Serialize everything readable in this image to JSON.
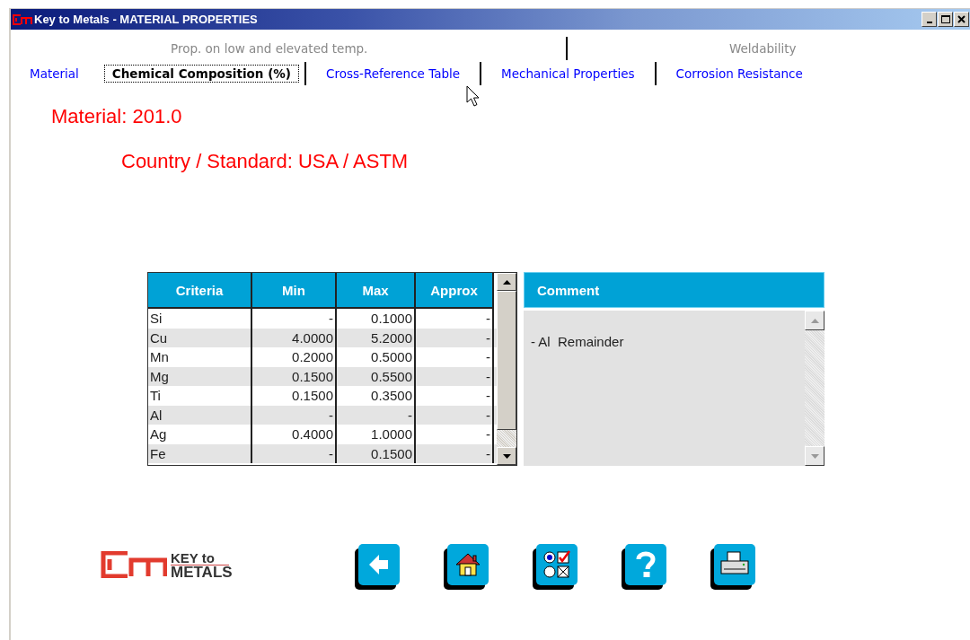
{
  "window": {
    "title": "Key to Metals - MATERIAL PROPERTIES"
  },
  "tabs_top": [
    {
      "label": "Prop. on low and elevated temp.",
      "disabled": true
    },
    {
      "label": "Weldability",
      "disabled": true
    }
  ],
  "tabs": [
    {
      "label": "Material",
      "selected": false
    },
    {
      "label": "Chemical Composition (%)",
      "selected": true
    },
    {
      "label": "Cross-Reference Table",
      "selected": false
    },
    {
      "label": "Mechanical Properties",
      "selected": false
    },
    {
      "label": "Corrosion Resistance",
      "selected": false
    }
  ],
  "material": "Material: 201.0",
  "country": "Country / Standard: USA / ASTM",
  "table": {
    "columns": [
      "Criteria",
      "Min",
      "Max",
      "Approx"
    ],
    "rows": [
      [
        "Si",
        "-",
        "0.1000",
        "-"
      ],
      [
        "Cu",
        "4.0000",
        "5.2000",
        "-"
      ],
      [
        "Mn",
        "0.2000",
        "0.5000",
        "-"
      ],
      [
        "Mg",
        "0.1500",
        "0.5500",
        "-"
      ],
      [
        "Ti",
        "0.1500",
        "0.3500",
        "-"
      ],
      [
        "Al",
        "-",
        "-",
        "-"
      ],
      [
        "Ag",
        "0.4000",
        "1.0000",
        "-"
      ],
      [
        "Fe",
        "-",
        "0.1500",
        "-"
      ]
    ]
  },
  "comment": {
    "title": "Comment",
    "text": "- Al  Remainder"
  },
  "logo": {
    "line1": "KEY to",
    "line2": "METALS"
  },
  "buttons": [
    {
      "kind": "back"
    },
    {
      "kind": "home"
    },
    {
      "kind": "options"
    },
    {
      "kind": "help"
    },
    {
      "kind": "print"
    }
  ]
}
